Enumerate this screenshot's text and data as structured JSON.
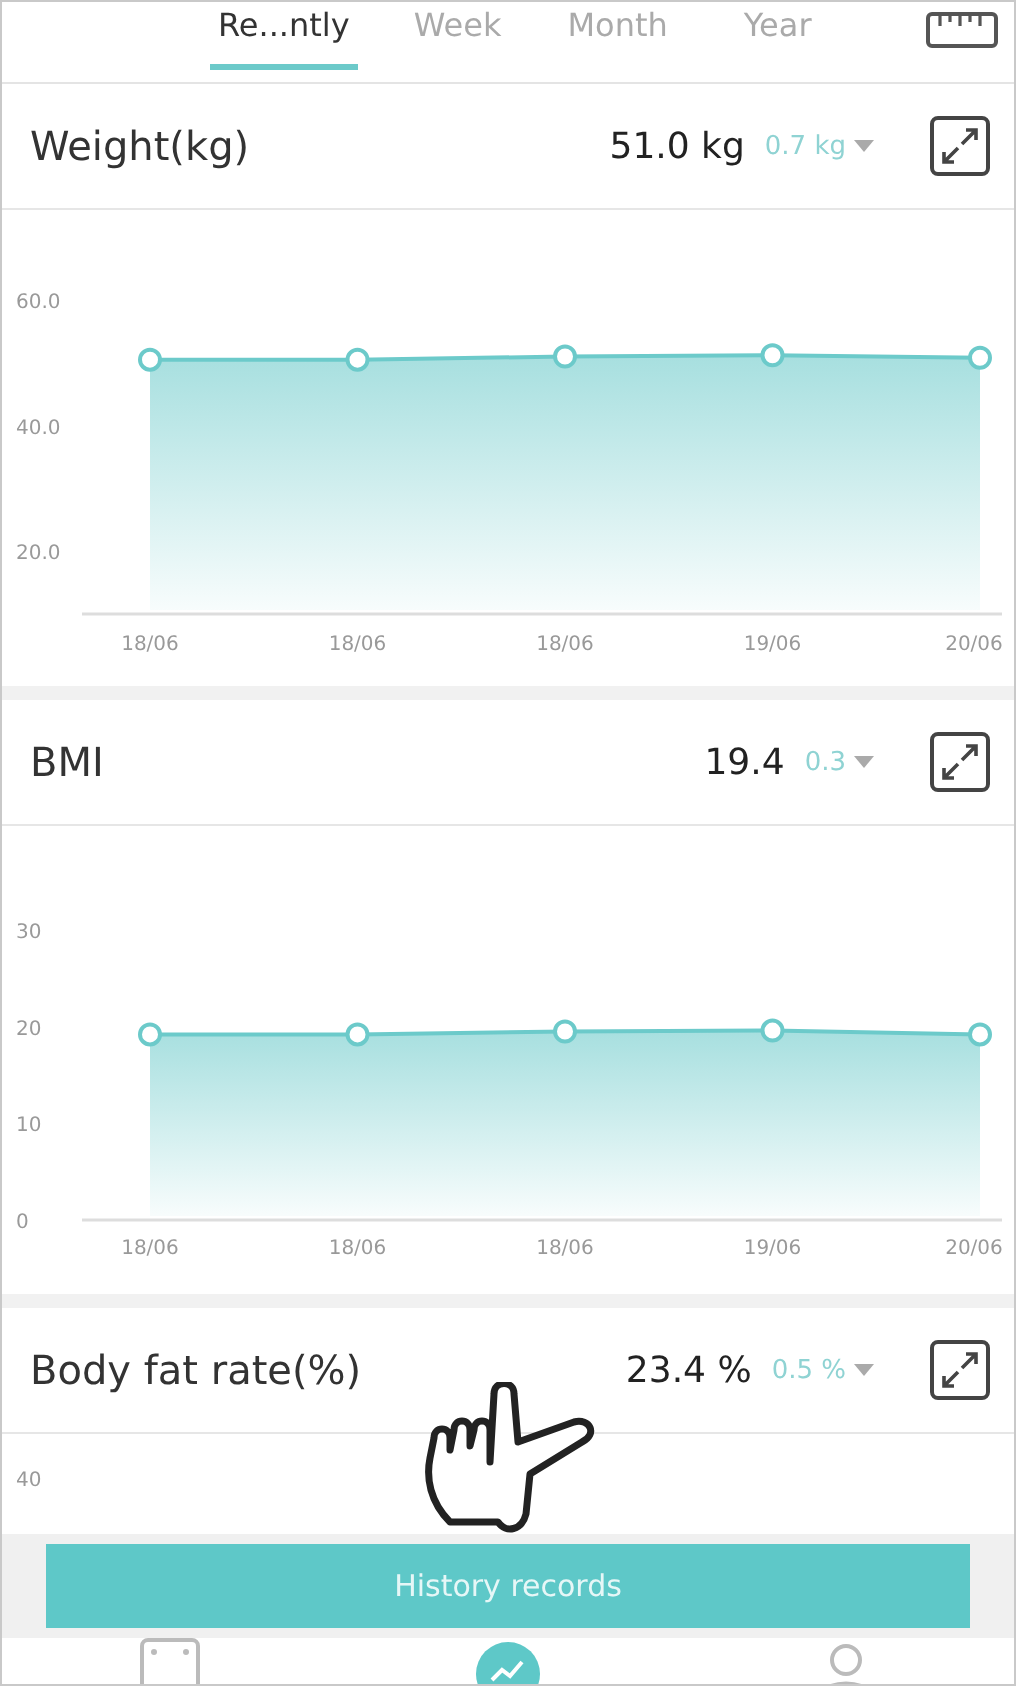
{
  "tabs": [
    {
      "label": "Re...ntly",
      "selected": true
    },
    {
      "label": "Week",
      "selected": false
    },
    {
      "label": "Month",
      "selected": false
    },
    {
      "label": "Year",
      "selected": false
    }
  ],
  "sections": [
    {
      "title": "Weight(kg)",
      "value": "51.0 kg",
      "change": "0.7 kg",
      "chart_data": {
        "type": "area",
        "categories": [
          "18/06",
          "18/06",
          "18/06",
          "19/06",
          "20/06"
        ],
        "series": [
          {
            "color": "#6ccaca",
            "values": [
              50.5,
              50.5,
              51.0,
              51.2,
              50.8
            ]
          }
        ],
        "ylim": [
          10,
          60
        ],
        "yticks": [
          {
            "value": 20,
            "label": "20.0"
          },
          {
            "value": 40,
            "label": "40.0"
          },
          {
            "value": 60,
            "label": "60.0"
          }
        ]
      }
    },
    {
      "title": "BMI",
      "value": "19.4",
      "change": "0.3",
      "chart_data": {
        "type": "area",
        "categories": [
          "18/06",
          "18/06",
          "18/06",
          "19/06",
          "20/06"
        ],
        "series": [
          {
            "color": "#6ccaca",
            "values": [
              19.2,
              19.2,
              19.5,
              19.6,
              19.2
            ]
          }
        ],
        "ylim": [
          0,
          30
        ],
        "yticks": [
          0,
          10,
          20,
          30
        ]
      }
    },
    {
      "title": "Body fat rate(%)",
      "value": "23.4 %",
      "change": "0.5 %",
      "axis_label": "40"
    }
  ],
  "history_button": "History records",
  "nav": [
    {
      "kind": "scan",
      "selected": false
    },
    {
      "kind": "trend",
      "selected": true
    },
    {
      "kind": "person",
      "selected": false
    }
  ]
}
